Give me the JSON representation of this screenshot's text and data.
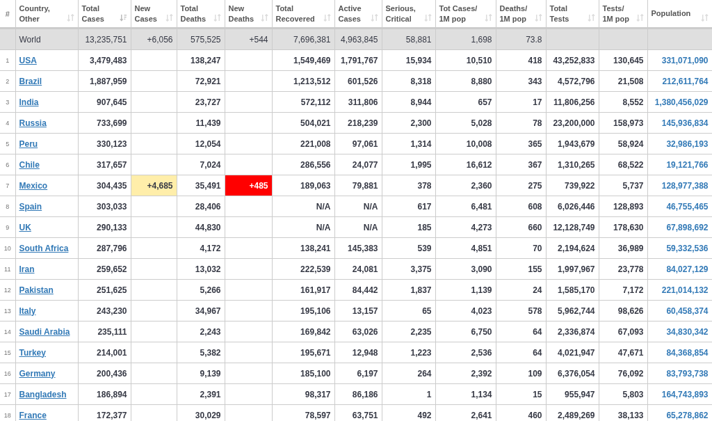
{
  "index_header": "#",
  "columns": [
    {
      "lines": [
        "Country,",
        "Other"
      ],
      "sorted": false
    },
    {
      "lines": [
        "Total",
        "Cases"
      ],
      "sorted": true
    },
    {
      "lines": [
        "New",
        "Cases"
      ],
      "sorted": false
    },
    {
      "lines": [
        "Total",
        "Deaths"
      ],
      "sorted": false
    },
    {
      "lines": [
        "New",
        "Deaths"
      ],
      "sorted": false
    },
    {
      "lines": [
        "Total",
        "Recovered"
      ],
      "sorted": false
    },
    {
      "lines": [
        "Active",
        "Cases"
      ],
      "sorted": false
    },
    {
      "lines": [
        "Serious,",
        "Critical"
      ],
      "sorted": false
    },
    {
      "lines": [
        "Tot Cases/",
        "1M pop"
      ],
      "sorted": false
    },
    {
      "lines": [
        "Deaths/",
        "1M pop"
      ],
      "sorted": false
    },
    {
      "lines": [
        "Total",
        "Tests"
      ],
      "sorted": false
    },
    {
      "lines": [
        "Tests/",
        "1M pop"
      ],
      "sorted": false
    },
    {
      "lines": [
        "Population"
      ],
      "sorted": false
    }
  ],
  "world": {
    "country": "World",
    "total_cases": "13,235,751",
    "new_cases": "+6,056",
    "total_deaths": "575,525",
    "new_deaths": "+544",
    "total_recovered": "7,696,381",
    "active_cases": "4,963,845",
    "serious_critical": "58,881",
    "tot_cases_1m": "1,698",
    "deaths_1m": "73.8"
  },
  "rows": [
    {
      "num": "1",
      "country": "USA",
      "total_cases": "3,479,483",
      "total_deaths": "138,247",
      "total_recovered": "1,549,469",
      "active_cases": "1,791,767",
      "serious_critical": "15,934",
      "tot_cases_1m": "10,510",
      "deaths_1m": "418",
      "total_tests": "43,252,833",
      "tests_1m": "130,645",
      "population": "331,071,090"
    },
    {
      "num": "2",
      "country": "Brazil",
      "total_cases": "1,887,959",
      "total_deaths": "72,921",
      "total_recovered": "1,213,512",
      "active_cases": "601,526",
      "serious_critical": "8,318",
      "tot_cases_1m": "8,880",
      "deaths_1m": "343",
      "total_tests": "4,572,796",
      "tests_1m": "21,508",
      "population": "212,611,764"
    },
    {
      "num": "3",
      "country": "India",
      "total_cases": "907,645",
      "total_deaths": "23,727",
      "total_recovered": "572,112",
      "active_cases": "311,806",
      "serious_critical": "8,944",
      "tot_cases_1m": "657",
      "deaths_1m": "17",
      "total_tests": "11,806,256",
      "tests_1m": "8,552",
      "population": "1,380,456,029"
    },
    {
      "num": "4",
      "country": "Russia",
      "total_cases": "733,699",
      "total_deaths": "11,439",
      "total_recovered": "504,021",
      "active_cases": "218,239",
      "serious_critical": "2,300",
      "tot_cases_1m": "5,028",
      "deaths_1m": "78",
      "total_tests": "23,200,000",
      "tests_1m": "158,973",
      "population": "145,936,834"
    },
    {
      "num": "5",
      "country": "Peru",
      "total_cases": "330,123",
      "total_deaths": "12,054",
      "total_recovered": "221,008",
      "active_cases": "97,061",
      "serious_critical": "1,314",
      "tot_cases_1m": "10,008",
      "deaths_1m": "365",
      "total_tests": "1,943,679",
      "tests_1m": "58,924",
      "population": "32,986,193"
    },
    {
      "num": "6",
      "country": "Chile",
      "total_cases": "317,657",
      "total_deaths": "7,024",
      "total_recovered": "286,556",
      "active_cases": "24,077",
      "serious_critical": "1,995",
      "tot_cases_1m": "16,612",
      "deaths_1m": "367",
      "total_tests": "1,310,265",
      "tests_1m": "68,522",
      "population": "19,121,766"
    },
    {
      "num": "7",
      "country": "Mexico",
      "total_cases": "304,435",
      "new_cases": "+4,685",
      "total_deaths": "35,491",
      "new_deaths": "+485",
      "total_recovered": "189,063",
      "active_cases": "79,881",
      "serious_critical": "378",
      "tot_cases_1m": "2,360",
      "deaths_1m": "275",
      "total_tests": "739,922",
      "tests_1m": "5,737",
      "population": "128,977,388"
    },
    {
      "num": "8",
      "country": "Spain",
      "total_cases": "303,033",
      "total_deaths": "28,406",
      "total_recovered": "N/A",
      "active_cases": "N/A",
      "serious_critical": "617",
      "tot_cases_1m": "6,481",
      "deaths_1m": "608",
      "total_tests": "6,026,446",
      "tests_1m": "128,893",
      "population": "46,755,465"
    },
    {
      "num": "9",
      "country": "UK",
      "total_cases": "290,133",
      "total_deaths": "44,830",
      "total_recovered": "N/A",
      "active_cases": "N/A",
      "serious_critical": "185",
      "tot_cases_1m": "4,273",
      "deaths_1m": "660",
      "total_tests": "12,128,749",
      "tests_1m": "178,630",
      "population": "67,898,692"
    },
    {
      "num": "10",
      "country": "South Africa",
      "total_cases": "287,796",
      "total_deaths": "4,172",
      "total_recovered": "138,241",
      "active_cases": "145,383",
      "serious_critical": "539",
      "tot_cases_1m": "4,851",
      "deaths_1m": "70",
      "total_tests": "2,194,624",
      "tests_1m": "36,989",
      "population": "59,332,536"
    },
    {
      "num": "11",
      "country": "Iran",
      "total_cases": "259,652",
      "total_deaths": "13,032",
      "total_recovered": "222,539",
      "active_cases": "24,081",
      "serious_critical": "3,375",
      "tot_cases_1m": "3,090",
      "deaths_1m": "155",
      "total_tests": "1,997,967",
      "tests_1m": "23,778",
      "population": "84,027,129"
    },
    {
      "num": "12",
      "country": "Pakistan",
      "total_cases": "251,625",
      "total_deaths": "5,266",
      "total_recovered": "161,917",
      "active_cases": "84,442",
      "serious_critical": "1,837",
      "tot_cases_1m": "1,139",
      "deaths_1m": "24",
      "total_tests": "1,585,170",
      "tests_1m": "7,172",
      "population": "221,014,132"
    },
    {
      "num": "13",
      "country": "Italy",
      "total_cases": "243,230",
      "total_deaths": "34,967",
      "total_recovered": "195,106",
      "active_cases": "13,157",
      "serious_critical": "65",
      "tot_cases_1m": "4,023",
      "deaths_1m": "578",
      "total_tests": "5,962,744",
      "tests_1m": "98,626",
      "population": "60,458,374"
    },
    {
      "num": "14",
      "country": "Saudi Arabia",
      "total_cases": "235,111",
      "total_deaths": "2,243",
      "total_recovered": "169,842",
      "active_cases": "63,026",
      "serious_critical": "2,235",
      "tot_cases_1m": "6,750",
      "deaths_1m": "64",
      "total_tests": "2,336,874",
      "tests_1m": "67,093",
      "population": "34,830,342"
    },
    {
      "num": "15",
      "country": "Turkey",
      "total_cases": "214,001",
      "total_deaths": "5,382",
      "total_recovered": "195,671",
      "active_cases": "12,948",
      "serious_critical": "1,223",
      "tot_cases_1m": "2,536",
      "deaths_1m": "64",
      "total_tests": "4,021,947",
      "tests_1m": "47,671",
      "population": "84,368,854"
    },
    {
      "num": "16",
      "country": "Germany",
      "total_cases": "200,436",
      "total_deaths": "9,139",
      "total_recovered": "185,100",
      "active_cases": "6,197",
      "serious_critical": "264",
      "tot_cases_1m": "2,392",
      "deaths_1m": "109",
      "total_tests": "6,376,054",
      "tests_1m": "76,092",
      "population": "83,793,738"
    },
    {
      "num": "17",
      "country": "Bangladesh",
      "total_cases": "186,894",
      "total_deaths": "2,391",
      "total_recovered": "98,317",
      "active_cases": "86,186",
      "serious_critical": "1",
      "tot_cases_1m": "1,134",
      "deaths_1m": "15",
      "total_tests": "955,947",
      "tests_1m": "5,803",
      "population": "164,743,893"
    },
    {
      "num": "18",
      "country": "France",
      "total_cases": "172,377",
      "total_deaths": "30,029",
      "total_recovered": "78,597",
      "active_cases": "63,751",
      "serious_critical": "492",
      "tot_cases_1m": "2,641",
      "deaths_1m": "460",
      "total_tests": "2,489,269",
      "tests_1m": "38,133",
      "population": "65,278,862"
    }
  ]
}
